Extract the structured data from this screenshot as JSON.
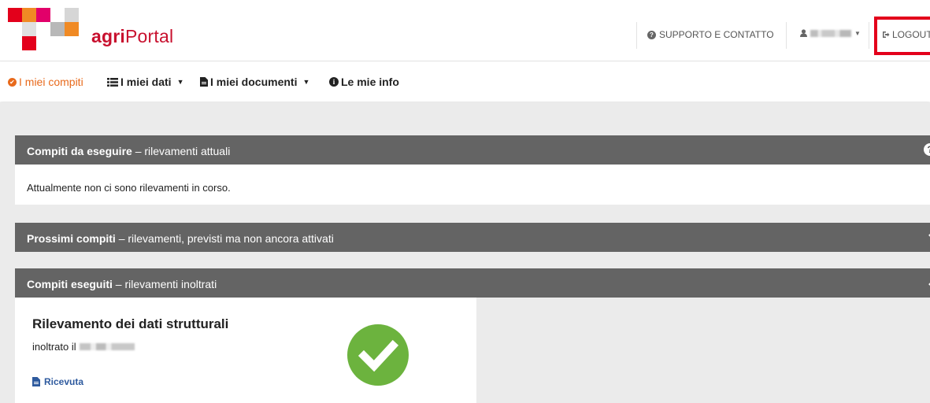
{
  "header": {
    "brand_bold": "agri",
    "brand_rest": "Portal",
    "support_label": "SUPPORTO E CONTATTO",
    "logout_label": "LOGOUT",
    "icons": {
      "support": "question-circle-icon",
      "user": "user-icon",
      "logout": "sign-out-icon"
    }
  },
  "nav": {
    "items": [
      {
        "label": "I miei compiti",
        "icon": "check-circle-icon",
        "active": true
      },
      {
        "label": "I miei dati",
        "icon": "list-icon"
      },
      {
        "label": "I miei documenti",
        "icon": "document-icon"
      },
      {
        "label": "Le mie info",
        "icon": "info-circle-icon"
      }
    ]
  },
  "panels": {
    "current": {
      "title_bold": "Compiti da eseguire",
      "title_rest": " – rilevamenti attuali",
      "body": "Attualmente non ci sono rilevamenti in corso.",
      "icon": "question-circle-icon"
    },
    "upcoming": {
      "title_bold": "Prossimi compiti",
      "title_rest": " – rilevamenti, previsti ma non ancora attivati",
      "icon": "chevron-down-icon"
    },
    "done": {
      "title_bold": "Compiti eseguiti",
      "title_rest": " – rilevamenti inoltrati",
      "icon": "chevron-up-icon"
    }
  },
  "card": {
    "title": "Rilevamento dei dati strutturali",
    "subtitle": "inoltrato il",
    "receipt_label": "Ricevuta",
    "status_icon": "check-circle-icon"
  },
  "colors": {
    "brand": "#c8102e",
    "active_nav": "#e86a1c",
    "panel_header": "#646464",
    "success": "#6cb33e",
    "link": "#2e5a9e"
  }
}
